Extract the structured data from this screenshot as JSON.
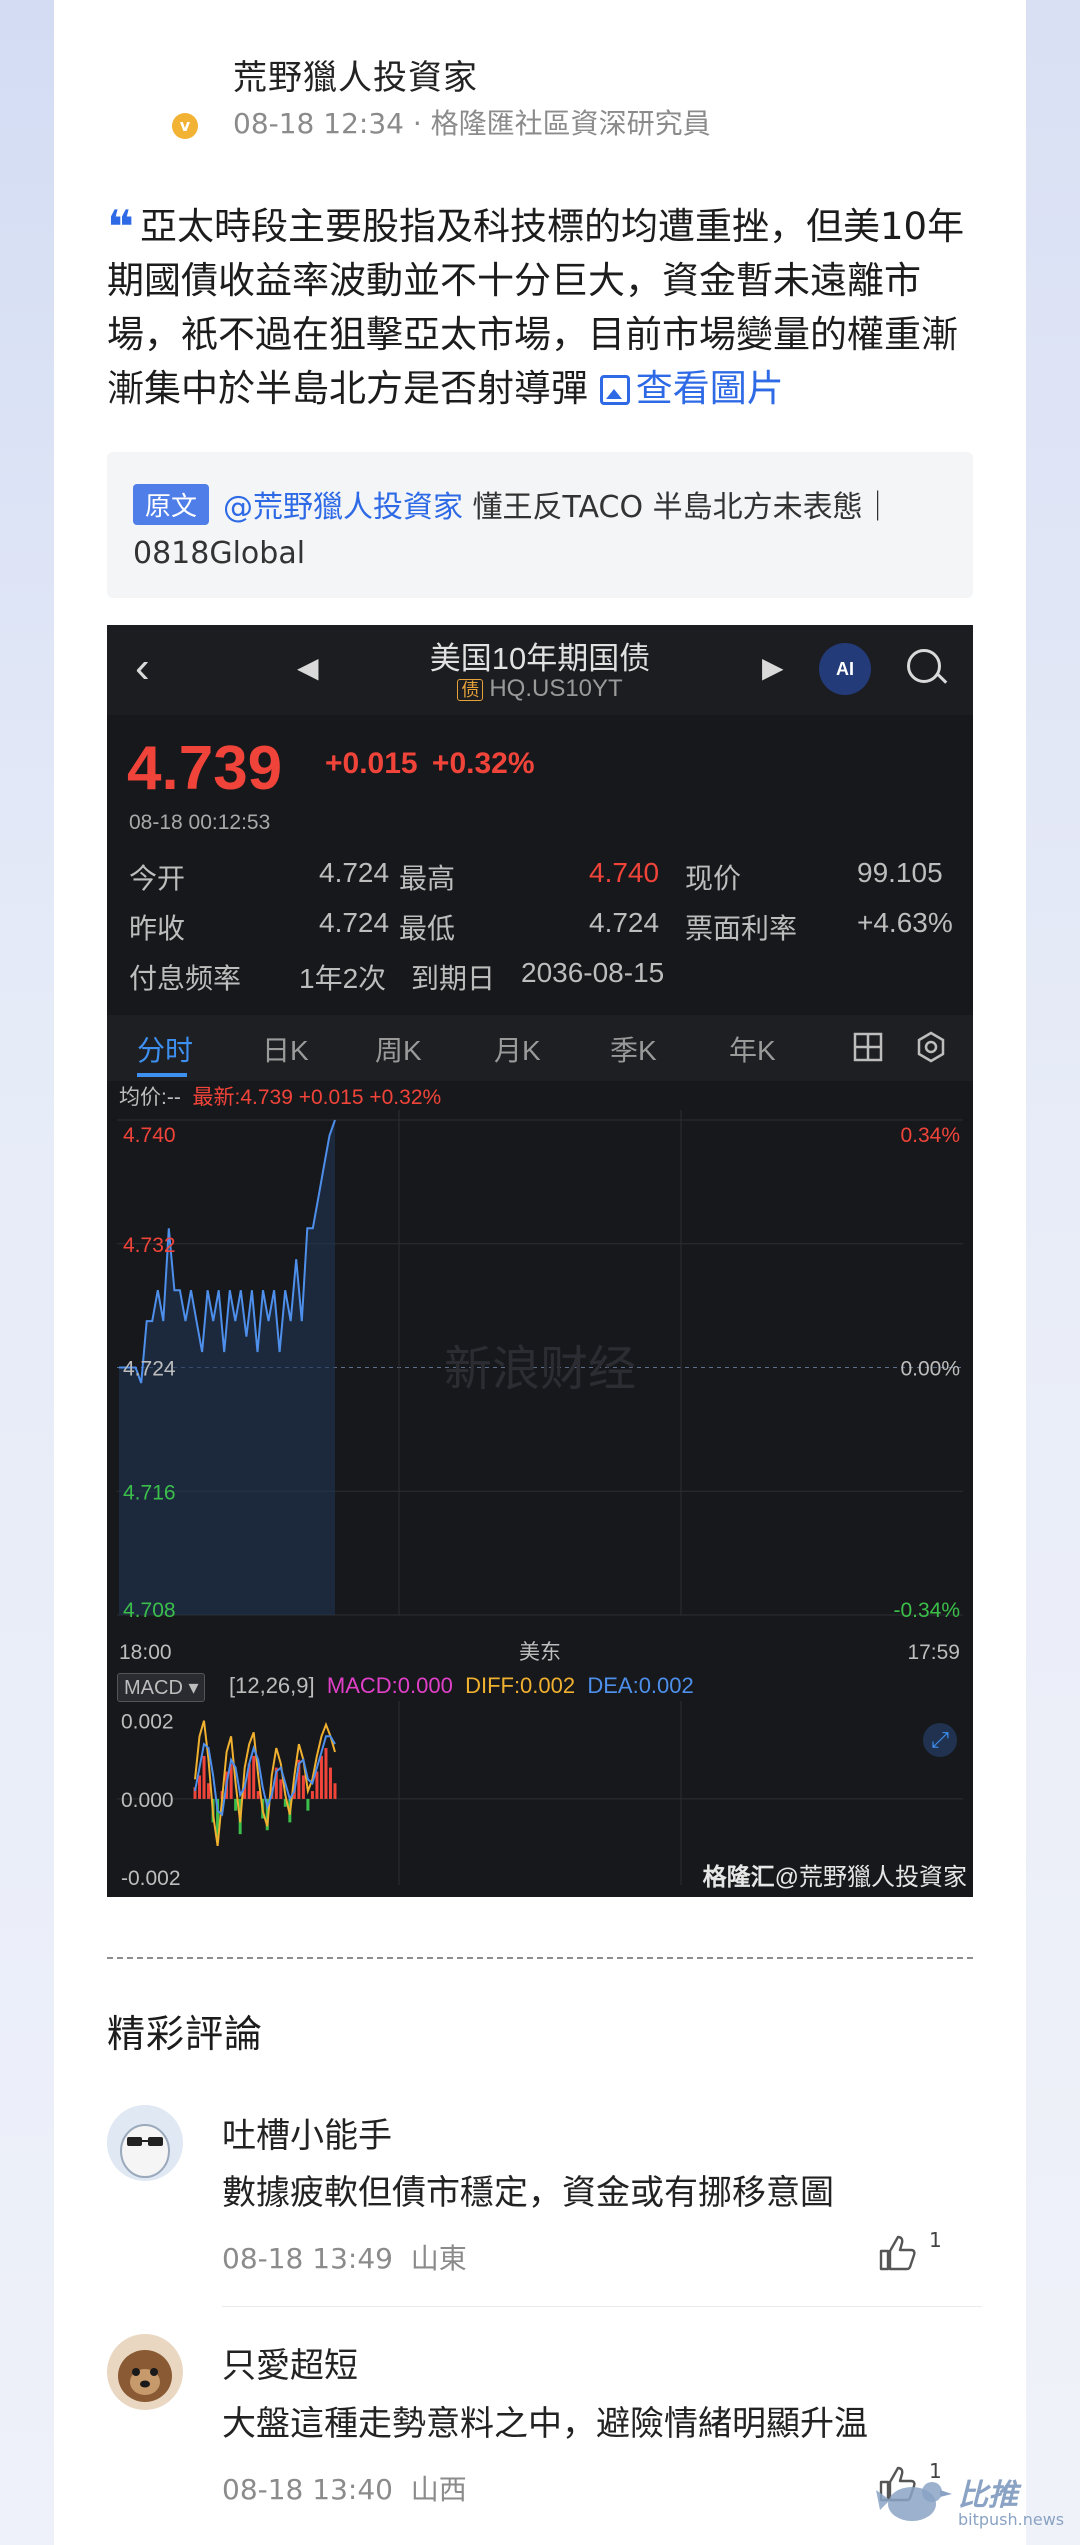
{
  "post": {
    "author": "荒野獵人投資家",
    "badge": "v",
    "meta": "08-18 12:34 · 格隆匯社區資深研究員",
    "quote_mark": "❝",
    "text": "亞太時段主要股指及科技標的均遭重挫，但美10年期國債收益率波動並不十分巨大，資金暫未遠離市場，衹不過在狙擊亞太市場，目前市場變量的權重漸漸集中於半島北方是否射導彈",
    "view_pic_label": "查看圖片"
  },
  "original": {
    "tag": "原文",
    "mention": "@荒野獵人投資家",
    "line1_rest": " 懂王反TACO 半島北方未表態｜",
    "line2": "0818Global"
  },
  "stock": {
    "title": "美国10年期国债",
    "bond_tag": "债",
    "code": "HQ.US10YT",
    "ai_label": "AI",
    "price": "4.739",
    "change": "+0.015 +0.32%",
    "time": "08-18 00:12:53",
    "rows": [
      [
        "今开",
        "4.724",
        "最高",
        "4.740",
        "现价",
        "99.105"
      ],
      [
        "昨收",
        "4.724",
        "最低",
        "4.724",
        "票面利率",
        "+4.63%"
      ]
    ],
    "freq_label": "付息频率",
    "freq_value": "1年2次",
    "maturity_label": "到期日",
    "maturity_value": "2036-08-15",
    "tabs": [
      "分时",
      "日K",
      "周K",
      "月K",
      "季K",
      "年K"
    ],
    "avg_label": "均价:--",
    "latest_label": "最新:4.739 +0.015 +0.32%",
    "macd_select": "MACD ▾",
    "macd_params": "[12,26,9]",
    "macd_val": "MACD:0.000",
    "diff_val": "DIFF:0.002",
    "dea_val": "DEA:0.002",
    "watermark_logo": "格隆汇",
    "watermark_user": "@荒野獵人投資家",
    "chart_watermark": "新浪财经",
    "colors": {
      "up": "#f0443a",
      "down": "#3bbf4a",
      "line": "#4d8fea",
      "accent": "#3d8ff0"
    }
  },
  "chart_data": [
    {
      "type": "line",
      "title": "",
      "y_labels_left": [
        "4.740",
        "4.732",
        "4.724",
        "4.716",
        "4.708"
      ],
      "y_labels_right": [
        "0.34%",
        "",
        "0.00%",
        "",
        "-0.34%"
      ],
      "x_labels": [
        "18:00",
        "美东",
        "17:59"
      ],
      "ylim": [
        4.708,
        4.74
      ],
      "series": [
        {
          "values": [
            4.724,
            4.724,
            4.724,
            4.724,
            4.723,
            4.727,
            4.727,
            4.729,
            4.727,
            4.733,
            4.729,
            4.729,
            4.727,
            4.729,
            4.727,
            4.725,
            4.729,
            4.727,
            4.729,
            4.725,
            4.729,
            4.727,
            4.729,
            4.726,
            4.729,
            4.725,
            4.729,
            4.727,
            4.729,
            4.725,
            4.729,
            4.727,
            4.731,
            4.727,
            4.733,
            4.733,
            4.735,
            4.737,
            4.739,
            4.74
          ]
        }
      ]
    },
    {
      "type": "bar",
      "title": "",
      "y_labels": [
        "0.002",
        "0.000",
        "-0.002"
      ],
      "ylim": [
        -0.0022,
        0.0024
      ],
      "macd_hist": [
        0.0003,
        0.0006,
        0.0011,
        0.0004,
        -0.0006,
        -0.0011,
        0.0002,
        0.0007,
        0.0009,
        -0.0003,
        -0.0009,
        0.0004,
        0.0009,
        0.0011,
        0.0002,
        -0.0005,
        -0.0008,
        0.0003,
        0.0008,
        0.0005,
        -0.0002,
        -0.0006,
        0.0004,
        0.001,
        0.0006,
        -0.0003,
        0.0002,
        0.0007,
        0.0011,
        0.0013,
        0.0008,
        0.0004
      ],
      "series": [
        {
          "name": "DIFF",
          "values": [
            0.0005,
            0.0016,
            0.002,
            0.001,
            -0.0004,
            -0.0012,
            0.0,
            0.0012,
            0.0016,
            0.0004,
            -0.0006,
            0.0008,
            0.0014,
            0.0017,
            0.0006,
            -0.0003,
            -0.0007,
            0.0006,
            0.0013,
            0.0009,
            0.0001,
            -0.0004,
            0.0006,
            0.0014,
            0.001,
            0.0002,
            0.0005,
            0.0011,
            0.0016,
            0.0019,
            0.0016,
            0.0012
          ]
        },
        {
          "name": "DEA",
          "values": [
            0.0002,
            0.0008,
            0.0014,
            0.0013,
            0.0006,
            -0.0003,
            -0.0004,
            0.0004,
            0.001,
            0.0008,
            0.0001,
            0.0003,
            0.0009,
            0.0013,
            0.001,
            0.0003,
            -0.0002,
            0.0001,
            0.0007,
            0.0008,
            0.0004,
            0.0,
            0.0002,
            0.0009,
            0.001,
            0.0005,
            0.0004,
            0.0008,
            0.0012,
            0.0016,
            0.0016,
            0.0014
          ]
        }
      ]
    }
  ],
  "divider": "",
  "comments": {
    "title": "精彩評論",
    "items": [
      {
        "name": "吐槽小能手",
        "text": "數據疲軟但債市穩定，資金或有挪移意圖",
        "time": "08-18 13:49",
        "location": "山東",
        "likes": "1"
      },
      {
        "name": "只愛超短",
        "text": "大盤這種走勢意料之中，避險情緒明顯升温",
        "time": "08-18 13:40",
        "location": "山西",
        "likes": "1"
      }
    ]
  },
  "bitpush": {
    "name": "比推",
    "url": "bitpush.news"
  }
}
